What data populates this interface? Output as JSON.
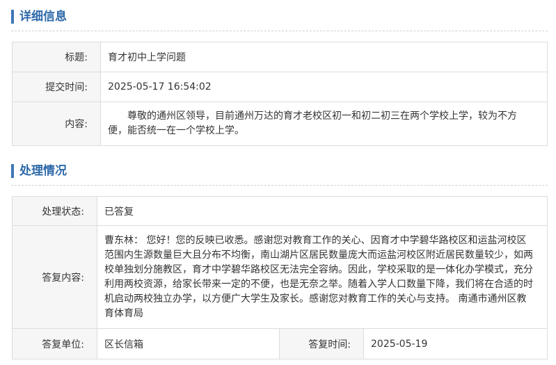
{
  "detail": {
    "section_title": "详细信息",
    "rows": {
      "title_label": "标题:",
      "title_value": "育才初中上学问题",
      "time_label": "提交时间:",
      "time_value": "2025-05-17 16:54:02",
      "content_label": "内容:",
      "content_value": "尊敬的通州区领导，目前通州万达的育才老校区初一和初二初三在两个学校上学，较为不方便，能否统一在一个学校上学。"
    }
  },
  "handling": {
    "section_title": "处理情况",
    "status_label": "处理状态:",
    "status_value": "已答复",
    "reply_label": "答复内容:",
    "reply_value": "曹东林： 您好！您的反映已收悉。感谢您对教育工作的关心、因育才中学碧华路校区和运盐河校区范围内生源数量巨大且分布不均衡，南山湖片区居民数量庞大而运盐河校区附近居民数量较少，如两校单独划分施教区，育才中学碧华路校区无法完全容纳。因此，学校采取的是一体化办学模式，充分利用两校资源，给家长带来一定的不便，也是无奈之举。随着入学人口数量下降，我们将在合适的时机启动两校独立办学，以方便广大学生及家长。感谢您对教育工作的关心与支持。 南通市通州区教育体育局",
    "unit_label": "答复单位:",
    "unit_value": "区长信箱",
    "reply_time_label": "答复时间:",
    "reply_time_value": "2025-05-19"
  }
}
